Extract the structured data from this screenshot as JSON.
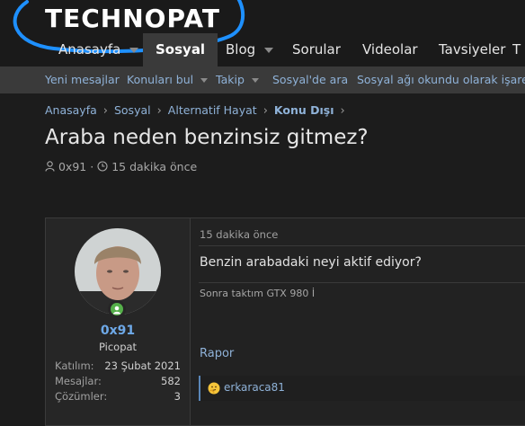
{
  "brand": {
    "logo_text": "TECHNOPAT"
  },
  "nav": {
    "items": [
      {
        "label": "Anasayfa",
        "has_menu": true
      },
      {
        "label": "Sosyal",
        "active": true
      },
      {
        "label": "Blog",
        "has_menu": true
      },
      {
        "label": "Sorular"
      },
      {
        "label": "Videolar"
      },
      {
        "label": "Tavsiyeler"
      }
    ]
  },
  "subnav": {
    "items": [
      {
        "label": "Yeni mesajlar"
      },
      {
        "label": "Konuları bul",
        "has_menu": true
      },
      {
        "label": "Takip",
        "has_menu": true
      },
      {
        "label": "Sosyal'de ara"
      },
      {
        "label": "Sosyal ağı okundu olarak işaretle"
      }
    ]
  },
  "breadcrumb": [
    "Anasayfa",
    "Sosyal",
    "Alternatif Hayat",
    "Konu Dışı"
  ],
  "thread": {
    "title": "Araba neden benzinsiz gitmez?",
    "author": "0x91",
    "time": "15 dakika önce"
  },
  "post": {
    "user": {
      "name": "0x91",
      "title": "Picopat",
      "stats": [
        {
          "label": "Katılım:",
          "value": "23 Şubat 2021"
        },
        {
          "label": "Mesajlar:",
          "value": "582"
        },
        {
          "label": "Çözümler:",
          "value": "3"
        }
      ]
    },
    "date": "15 dakika önce",
    "body": "Benzin arabadaki neyi aktif ediyor?",
    "signature": "Sonra taktım GTX 980 İ",
    "report_label": "Rapor",
    "reaction_user": "erkaracа81"
  },
  "colors": {
    "link": "#8fb2d8",
    "username": "#6ea9e8",
    "online": "#55b04a",
    "annotation": "#1e90ff"
  }
}
